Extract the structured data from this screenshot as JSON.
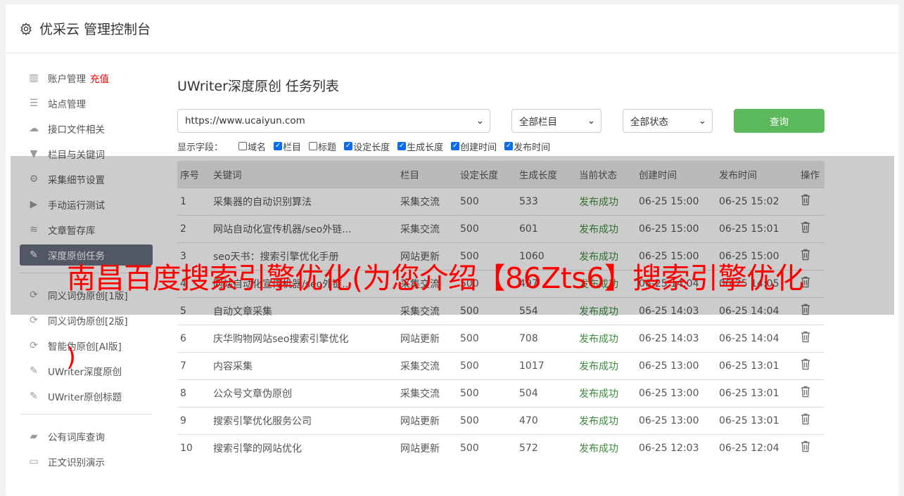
{
  "header": {
    "title": "优采云 管理控制台",
    "icon": "gear-icon"
  },
  "sidebar": {
    "items": [
      {
        "label": "账户管理",
        "extra": "充值",
        "icon": "bar-chart-icon"
      },
      {
        "label": "站点管理",
        "icon": "server-icon"
      },
      {
        "label": "接口文件相关",
        "icon": "cloud-upload-icon"
      },
      {
        "label": "栏目与关键词",
        "icon": "filter-icon"
      },
      {
        "label": "采集细节设置",
        "icon": "gears-icon"
      },
      {
        "label": "手动运行测试",
        "icon": "play-icon"
      },
      {
        "label": "文章暂存库",
        "icon": "database-icon"
      },
      {
        "label": "深度原创任务",
        "icon": "edit-icon",
        "active": true
      },
      {
        "label": "同义词伪原创[1版]",
        "icon": "refresh-icon"
      },
      {
        "label": "同义词伪原创[2版]",
        "icon": "refresh-icon"
      },
      {
        "label": "智能伪原创[AI版]",
        "icon": "refresh-icon"
      },
      {
        "label": "UWriter深度原创",
        "icon": "edit-icon"
      },
      {
        "label": "UWriter原创标题",
        "icon": "edit-icon"
      },
      {
        "label": "公有词库查询",
        "icon": "book-icon"
      },
      {
        "label": "正文识别演示",
        "icon": "monitor-icon"
      }
    ]
  },
  "main": {
    "title": "UWriter深度原创 任务列表",
    "site_select": "https://www.ucaiyun.com",
    "column_select": "全部栏目",
    "status_select": "全部状态",
    "query_button": "查询",
    "fields_label": "显示字段：",
    "fields": [
      {
        "label": "域名",
        "checked": false
      },
      {
        "label": "栏目",
        "checked": true
      },
      {
        "label": "标题",
        "checked": false
      },
      {
        "label": "设定长度",
        "checked": true
      },
      {
        "label": "生成长度",
        "checked": true
      },
      {
        "label": "创建时间",
        "checked": true
      },
      {
        "label": "发布时间",
        "checked": true
      }
    ],
    "columns": [
      "序号",
      "关键词",
      "栏目",
      "设定长度",
      "生成长度",
      "当前状态",
      "创建时间",
      "发布时间",
      "操作"
    ],
    "rows": [
      [
        "1",
        "采集器的自动识别算法",
        "采集交流",
        "500",
        "533",
        "发布成功",
        "06-25 15:00",
        "06-25 15:02"
      ],
      [
        "2",
        "网站自动化宣传机器/seo外链...",
        "采集交流",
        "500",
        "601",
        "发布成功",
        "06-25 15:00",
        "06-25 15:01"
      ],
      [
        "3",
        "seo天书：搜索引擎优化手册",
        "网站更新",
        "500",
        "1060",
        "发布成功",
        "06-25 15:00",
        "06-25 15:00"
      ],
      [
        "4",
        "网站自动化宣传机器/seo外链...",
        "采集交流",
        "500",
        "497",
        "发布成功",
        "06-25 14:04",
        "06-25 14:05"
      ],
      [
        "5",
        "自动文章采集",
        "采集交流",
        "500",
        "554",
        "发布成功",
        "06-25 14:03",
        "06-25 14:04"
      ],
      [
        "6",
        "庆华购物网站seo搜索引擎优化",
        "网站更新",
        "500",
        "708",
        "发布成功",
        "06-25 14:03",
        "06-25 14:04"
      ],
      [
        "7",
        "内容采集",
        "采集交流",
        "500",
        "1017",
        "发布成功",
        "06-25 13:00",
        "06-25 13:01"
      ],
      [
        "8",
        "公众号文章伪原创",
        "采集交流",
        "500",
        "504",
        "发布成功",
        "06-25 13:00",
        "06-25 13:01"
      ],
      [
        "9",
        "搜索引擎优化服务公司",
        "网站更新",
        "500",
        "470",
        "发布成功",
        "06-25 13:00",
        "06-25 13:01"
      ],
      [
        "10",
        "搜索引擎的网站优化",
        "网站更新",
        "500",
        "572",
        "发布成功",
        "06-25 12:03",
        "06-25 12:04"
      ]
    ]
  },
  "watermark": {
    "line1": "南昌百度搜索引擎优化(为您介绍【86Zts6】搜索引擎优化",
    "line2": ")"
  },
  "colors": {
    "accent": "#5cb85c",
    "status_ok": "#3c8b3c",
    "watermark": "#ff0000"
  }
}
